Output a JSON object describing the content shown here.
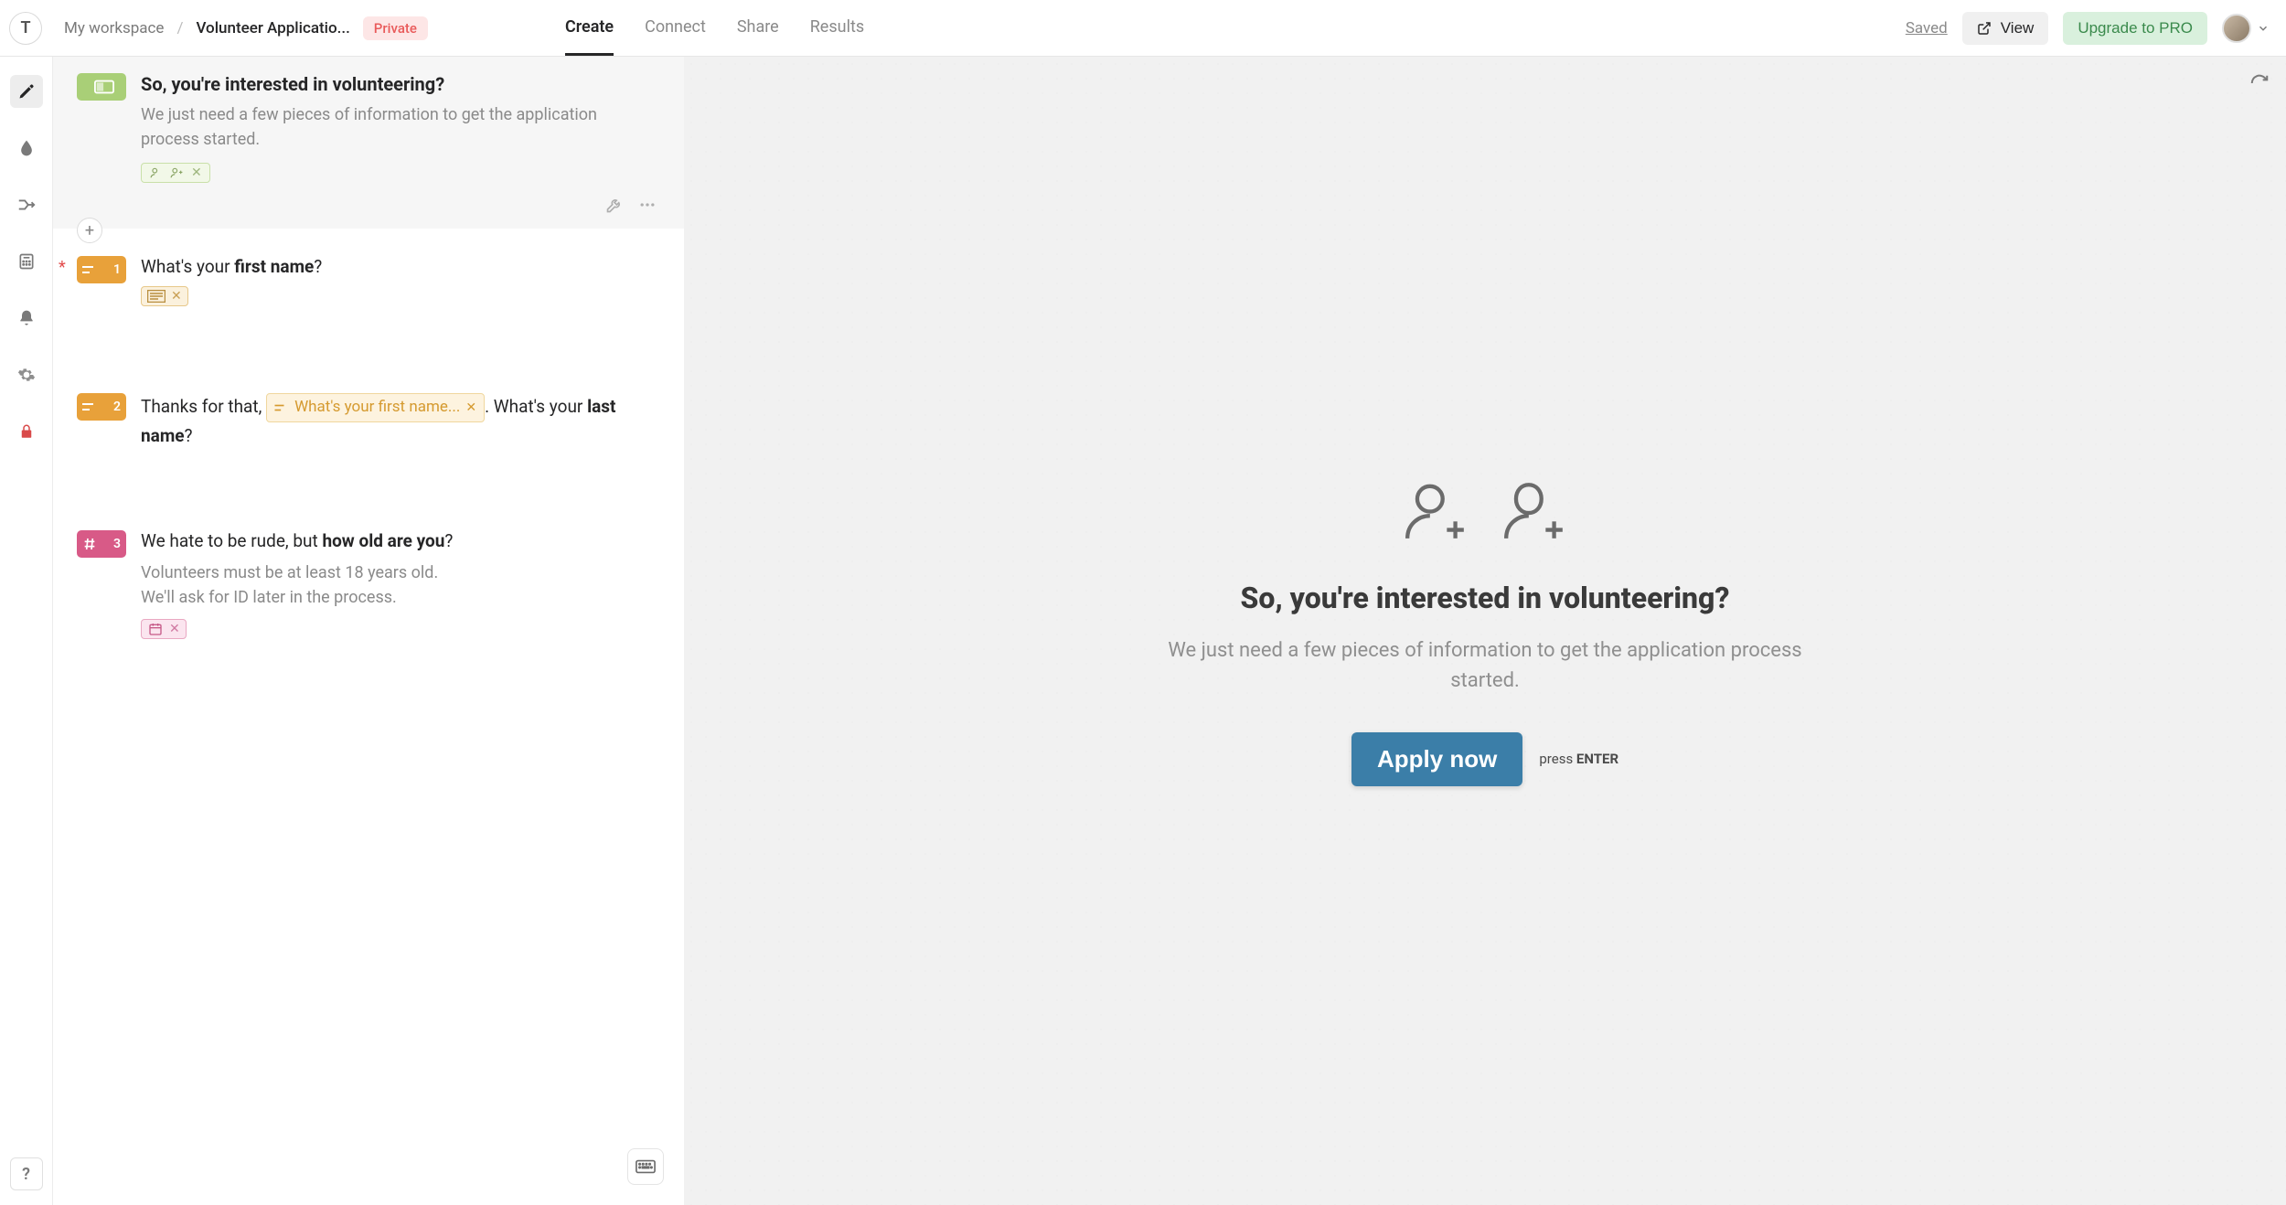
{
  "header": {
    "logo_letter": "T",
    "breadcrumb": {
      "workspace": "My workspace",
      "form": "Volunteer Applicatio..."
    },
    "private_badge": "Private",
    "tabs": {
      "create": "Create",
      "connect": "Connect",
      "share": "Share",
      "results": "Results"
    },
    "saved": "Saved",
    "view_btn": "View",
    "upgrade_btn": "Upgrade to PRO"
  },
  "welcome": {
    "title": "So, you're interested in volunteering?",
    "desc": "We just need a few pieces of information to get the application process started."
  },
  "q1": {
    "num": "1",
    "prefix": "What's your ",
    "bold": "first name",
    "suffix": "?"
  },
  "q2": {
    "num": "2",
    "prefix": "Thanks for that, ",
    "recall": "What's your first name...",
    "mid": ". What's your ",
    "bold": "last name",
    "suffix": "?"
  },
  "q3": {
    "num": "3",
    "prefix": "We hate to be rude, but ",
    "bold": "how old are you",
    "suffix": "?",
    "desc1": "Volunteers must be at least 18 years old.",
    "desc2": "We'll ask for ID later in the process."
  },
  "preview": {
    "title": "So, you're interested in volunteering?",
    "desc": "We just need a few pieces of information to get the application process started.",
    "cta": "Apply now",
    "hint_prefix": "press ",
    "hint_key": "ENTER"
  }
}
